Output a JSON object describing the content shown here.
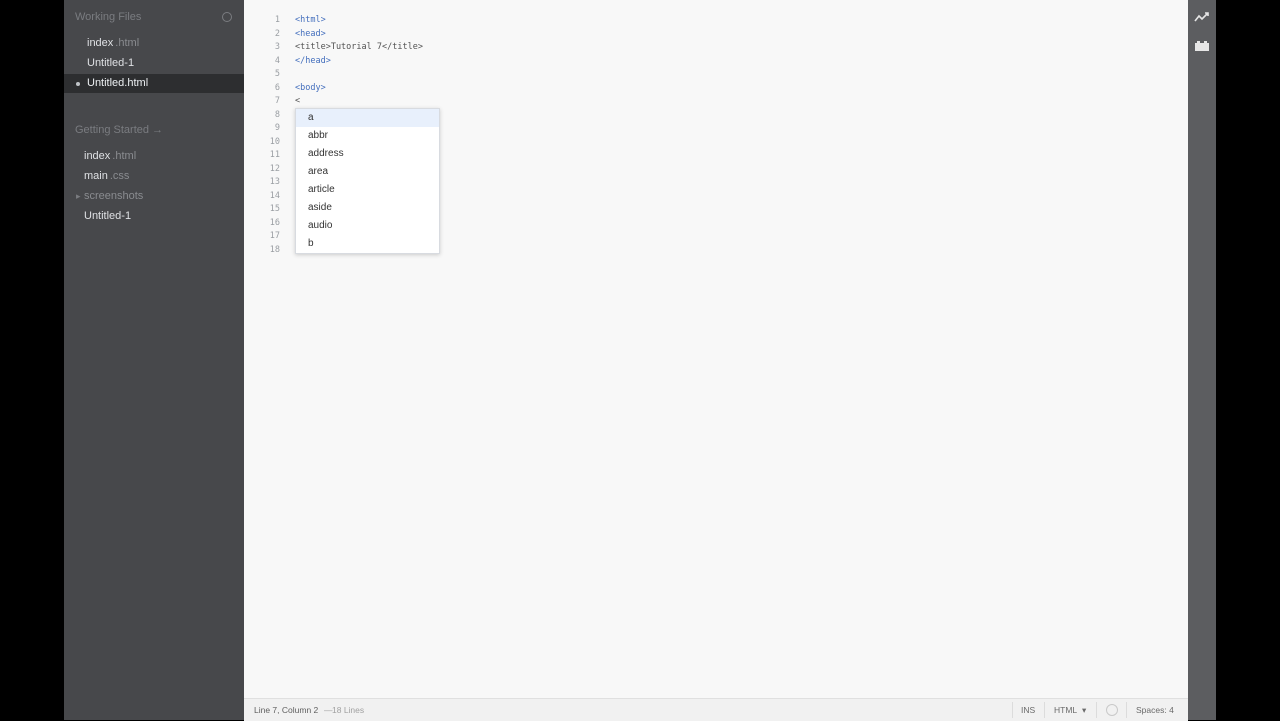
{
  "sidebar": {
    "working_files_header": "Working Files",
    "working_files": [
      {
        "name": "index",
        "ext": ".html"
      },
      {
        "name": "Untitled-1",
        "ext": ""
      },
      {
        "name": "Untitled.html",
        "ext": ""
      }
    ],
    "project_header": "Getting Started →",
    "project_files": [
      {
        "name": "index",
        "ext": ".html"
      },
      {
        "name": "main",
        "ext": ".css"
      },
      {
        "name": "screenshots",
        "ext": ""
      },
      {
        "name": "Untitled-1",
        "ext": ""
      }
    ]
  },
  "editor": {
    "line_numbers": [
      "1",
      "2",
      "3",
      "4",
      "5",
      "6",
      "7",
      "8",
      "9",
      "10",
      "11",
      "12",
      "13",
      "14",
      "15",
      "16",
      "17",
      "18"
    ],
    "code": [
      "<html>",
      "<head>",
      "<title>Tutorial 7</title>",
      "</head>",
      "",
      "<body>",
      "<"
    ],
    "autocomplete": [
      "a",
      "abbr",
      "address",
      "area",
      "article",
      "aside",
      "audio",
      "b"
    ]
  },
  "statusbar": {
    "cursor": "Line 7, Column 2",
    "separator": "—",
    "lines": "18 Lines",
    "mode": "INS",
    "language": "HTML",
    "language_arrow": "▾",
    "spaces": "Spaces: 4"
  },
  "toolbar": {
    "icons": [
      "live-preview-icon",
      "extension-manager-icon"
    ]
  }
}
